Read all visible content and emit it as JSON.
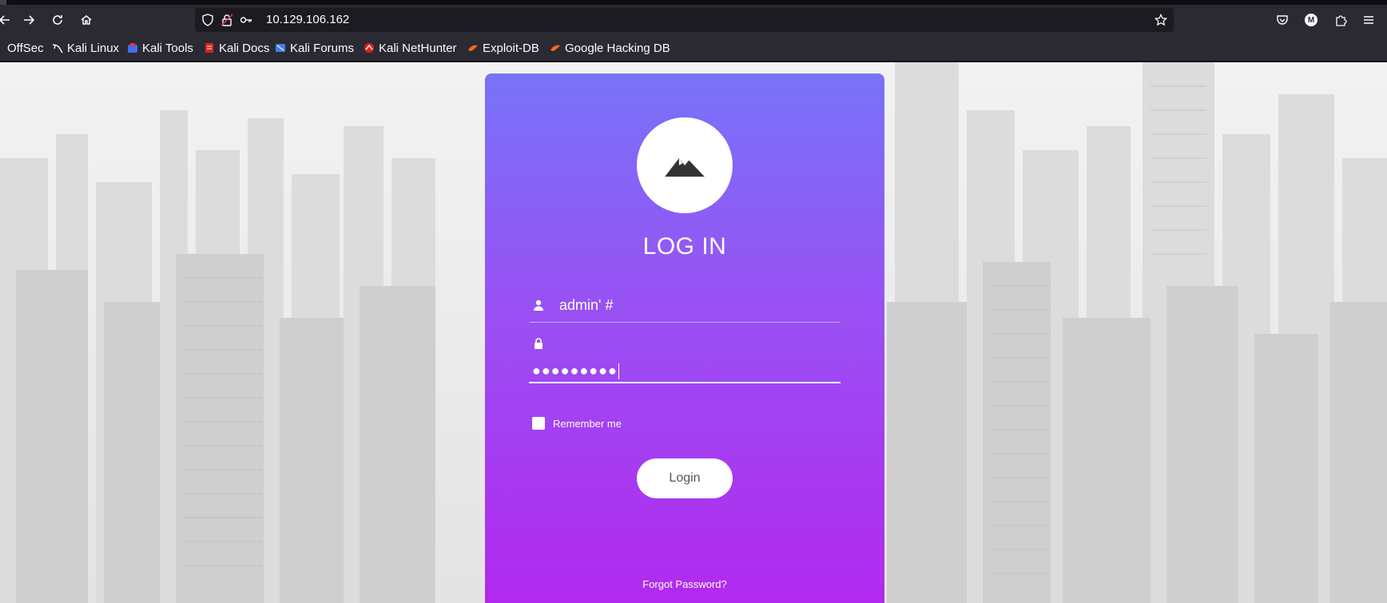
{
  "browser": {
    "url": "10.129.106.162",
    "bookmarks": [
      {
        "label": "OffSec",
        "icon": "offsec-icon"
      },
      {
        "label": "Kali Linux",
        "icon": "kali-dragon-icon"
      },
      {
        "label": "Kali Tools",
        "icon": "kali-tools-icon"
      },
      {
        "label": "Kali Docs",
        "icon": "kali-docs-icon"
      },
      {
        "label": "Kali Forums",
        "icon": "kali-forums-icon"
      },
      {
        "label": "Kali NetHunter",
        "icon": "nethunter-icon"
      },
      {
        "label": "Exploit-DB",
        "icon": "exploit-db-icon"
      },
      {
        "label": "Google Hacking DB",
        "icon": "ghdb-icon"
      }
    ],
    "account_initial": "M"
  },
  "login": {
    "title": "LOG IN",
    "username_value": "admin' #",
    "password_masked": "●●●●●●●●●",
    "remember_label": "Remember me",
    "remember_checked": false,
    "submit_label": "Login",
    "forgot_label": "Forgot Password?"
  },
  "colors": {
    "card_top": "#7873f9",
    "card_bottom": "#b327ee",
    "browser_chrome": "#2b2a33"
  }
}
